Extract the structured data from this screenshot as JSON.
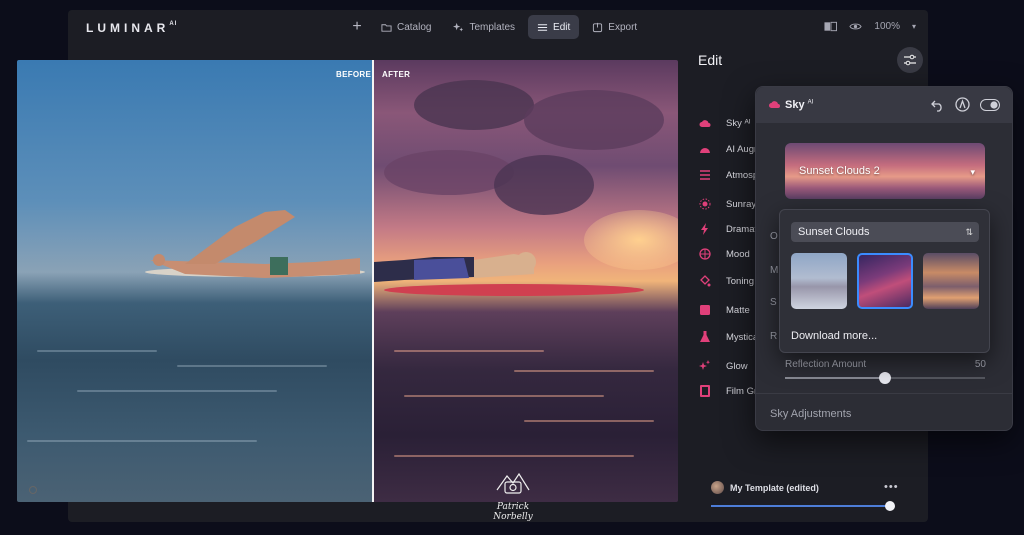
{
  "app": {
    "logo": "LUMINAR",
    "logo_sup": "AI"
  },
  "nav": {
    "add": "+",
    "items": [
      {
        "label": "Catalog",
        "icon": "folder-icon"
      },
      {
        "label": "Templates",
        "icon": "sparkle-icon"
      },
      {
        "label": "Edit",
        "icon": "sliders-icon",
        "active": true
      },
      {
        "label": "Export",
        "icon": "export-icon"
      }
    ],
    "zoom": "100%"
  },
  "photo": {
    "before_label": "BEFORE",
    "after_label": "AFTER",
    "before_fraction": 0.54
  },
  "edit_panel": {
    "title": "Edit",
    "tools": [
      {
        "label": "Sky ᴬᴵ",
        "icon": "cloud-icon"
      },
      {
        "label": "AI Augmented Sky",
        "icon": "cloud-half-icon"
      },
      {
        "label": "Atmosphere",
        "icon": "lines-icon"
      },
      {
        "label": "Sunrays",
        "icon": "sun-icon"
      },
      {
        "label": "Dramatic",
        "icon": "bolt-icon"
      },
      {
        "label": "Mood",
        "icon": "globe-icon"
      },
      {
        "label": "Toning",
        "icon": "bucket-icon"
      },
      {
        "label": "Matte",
        "icon": "square-icon"
      },
      {
        "label": "Mystical",
        "icon": "flask-icon"
      },
      {
        "label": "Glow",
        "icon": "stars-icon"
      },
      {
        "label": "Film Grain",
        "icon": "film-icon"
      }
    ],
    "partial_rows": [
      "O",
      "M",
      "S",
      "R"
    ]
  },
  "sky_panel": {
    "title": "Sky",
    "title_sup": "AI",
    "selected_sky": "Sunset Clouds 2",
    "reflection_label": "Reflection Amount",
    "reflection_value": "50",
    "reflection_fraction": 0.5,
    "adjustments_label": "Sky Adjustments"
  },
  "sky_dropdown": {
    "category": "Sunset Clouds",
    "thumbnails": [
      "Sunset Clouds 1",
      "Sunset Clouds 2",
      "Sunset Clouds 3"
    ],
    "selected_index": 1,
    "download_label": "Download more..."
  },
  "template": {
    "name": "My Template (edited)",
    "more": "•••",
    "amount_fraction": 1.0
  },
  "watermark": {
    "text": "Patrick Norbelly"
  },
  "colors": {
    "accent_pink": "#e0407a",
    "accent_blue": "#3b8cff",
    "panel_bg": "#1c1d24"
  }
}
